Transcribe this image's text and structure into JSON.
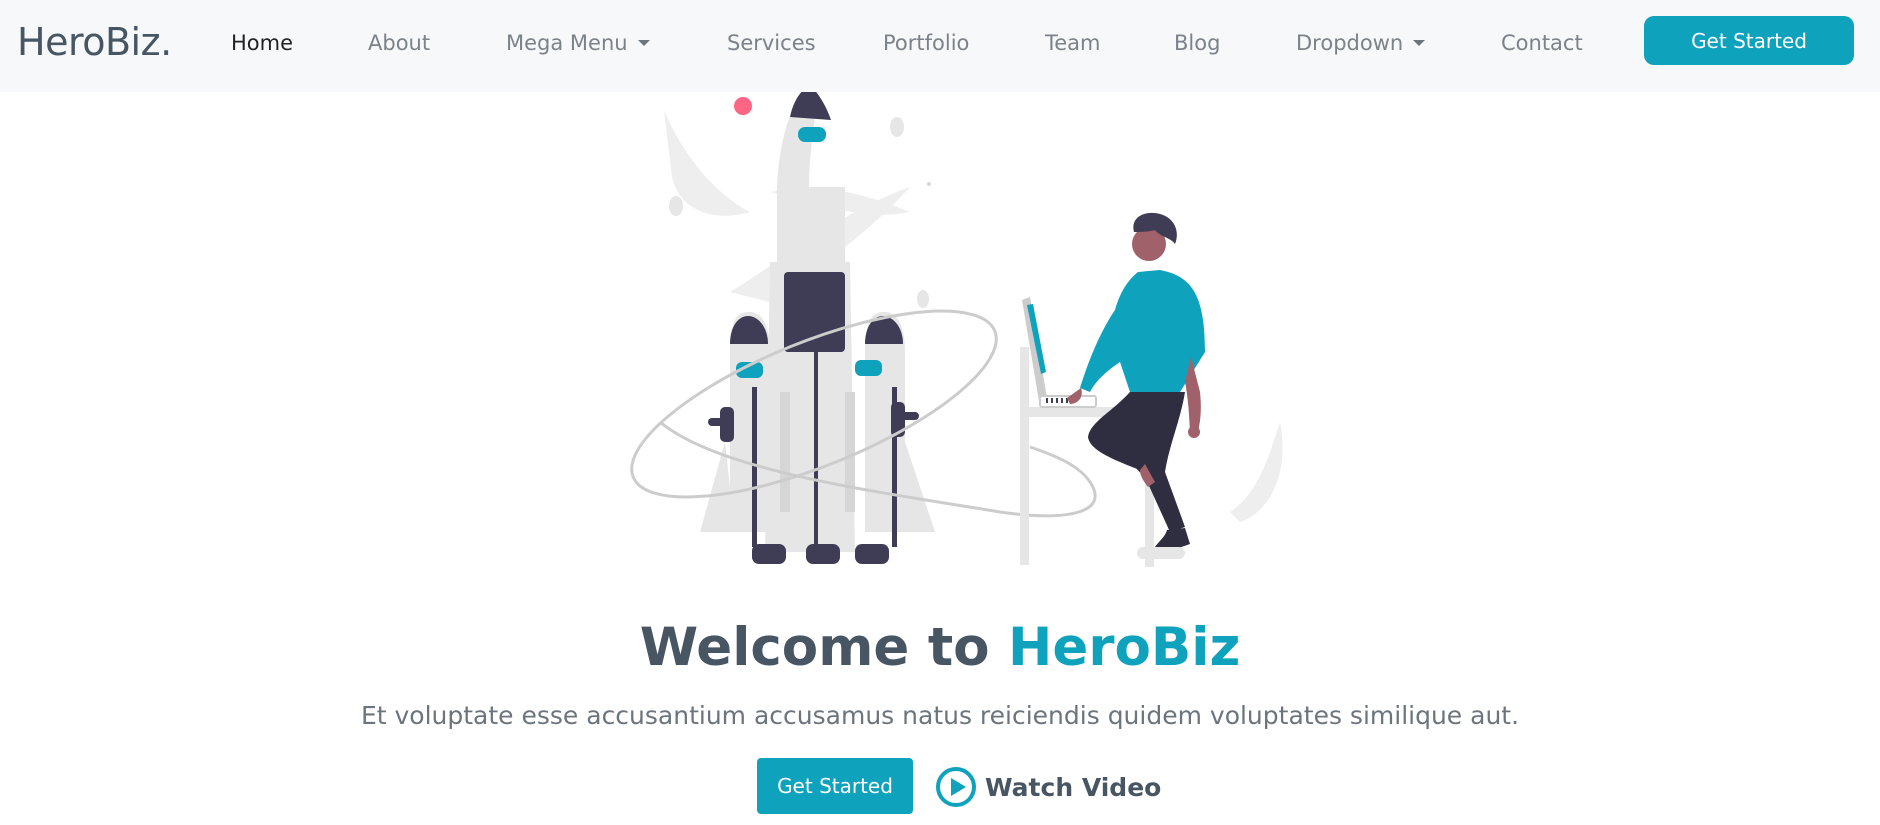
{
  "brand": {
    "name": "HeroBiz."
  },
  "nav": {
    "items": [
      {
        "label": "Home",
        "active": true
      },
      {
        "label": "About"
      },
      {
        "label": "Mega Menu",
        "dropdown": true
      },
      {
        "label": "Services"
      },
      {
        "label": "Portfolio"
      },
      {
        "label": "Team"
      },
      {
        "label": "Blog"
      },
      {
        "label": "Dropdown",
        "dropdown": true
      },
      {
        "label": "Contact"
      }
    ],
    "cta": "Get Started"
  },
  "hero": {
    "title_prefix": "Welcome to",
    "title_accent": "HeroBiz",
    "subtitle": "Et voluptate esse accusantium accusamus natus reiciendis quidem voluptates similique aut.",
    "primary_button": "Get Started",
    "video_button": "Watch Video",
    "video_icon": "play-circle-icon"
  },
  "colors": {
    "accent": "#0ea2bd",
    "heading": "#485664",
    "nav_bg": "#f6f8f9",
    "illustration_dark": "#3f3d56",
    "illustration_light": "#e6e6e6",
    "illustration_skin": "#a0616a",
    "illustration_pink": "#ff6584"
  }
}
